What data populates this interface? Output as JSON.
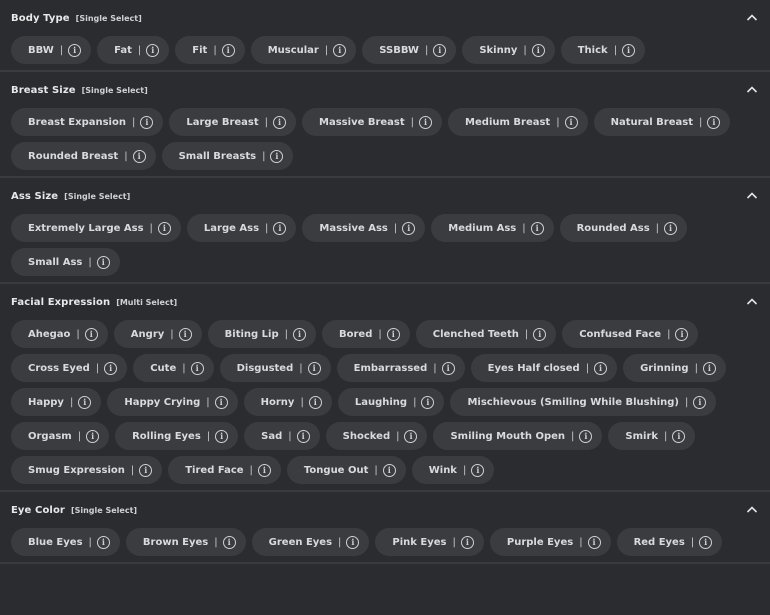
{
  "sections": [
    {
      "title": "Body Type",
      "note": "[Single Select]",
      "items": [
        "BBW",
        "Fat",
        "Fit",
        "Muscular",
        "SSBBW",
        "Skinny",
        "Thick"
      ]
    },
    {
      "title": "Breast Size",
      "note": "[Single Select]",
      "items": [
        "Breast Expansion",
        "Large Breast",
        "Massive Breast",
        "Medium Breast",
        "Natural Breast",
        "Rounded Breast",
        "Small Breasts"
      ]
    },
    {
      "title": "Ass Size",
      "note": "[Single Select]",
      "items": [
        "Extremely Large Ass",
        "Large Ass",
        "Massive Ass",
        "Medium Ass",
        "Rounded Ass",
        "Small Ass"
      ]
    },
    {
      "title": "Facial Expression",
      "note": "[Multi Select]",
      "items": [
        "Ahegao",
        "Angry",
        "Biting Lip",
        "Bored",
        "Clenched Teeth",
        "Confused Face",
        "Cross Eyed",
        "Cute",
        "Disgusted",
        "Embarrassed",
        "Eyes Half closed",
        "Grinning",
        "Happy",
        "Happy Crying",
        "Horny",
        "Laughing",
        "Mischievous (Smiling While Blushing)",
        "Orgasm",
        "Rolling Eyes",
        "Sad",
        "Shocked",
        "Smiling Mouth Open",
        "Smirk",
        "Smug Expression",
        "Tired Face",
        "Tongue Out",
        "Wink"
      ]
    },
    {
      "title": "Eye Color",
      "note": "[Single Select]",
      "items": [
        "Blue Eyes",
        "Brown Eyes",
        "Green Eyes",
        "Pink Eyes",
        "Purple Eyes",
        "Red Eyes"
      ]
    }
  ],
  "separator": "|",
  "info_glyph": "i",
  "icons": {
    "collapse": "chevron-up-icon",
    "info": "info-icon"
  }
}
